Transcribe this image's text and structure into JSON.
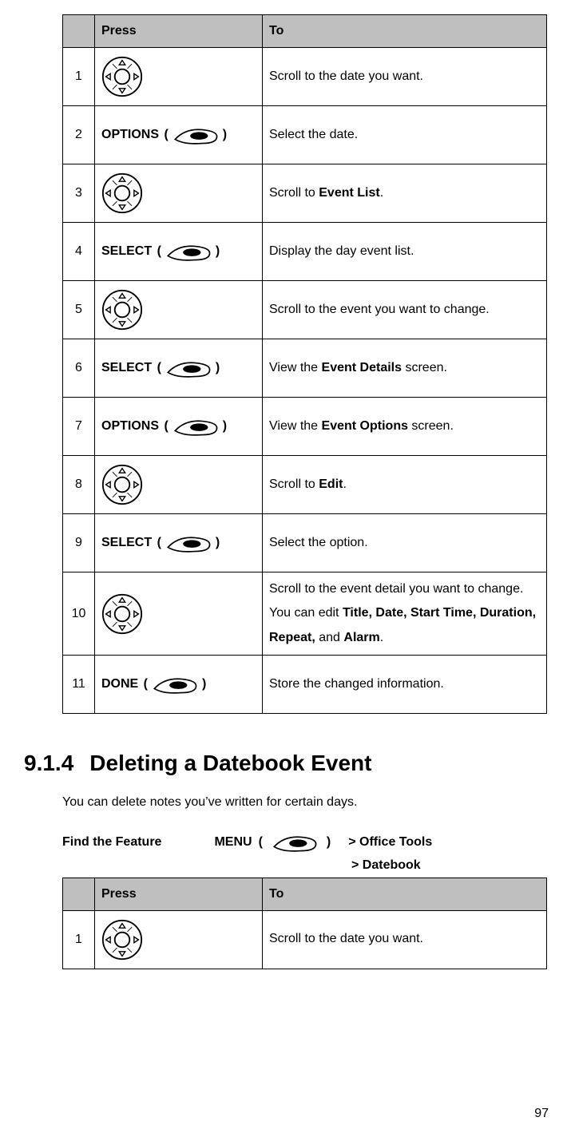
{
  "table1": {
    "headers": {
      "num": "",
      "press": "Press",
      "to": "To"
    },
    "rows": [
      {
        "num": "1",
        "press_type": "nav",
        "to": "Scroll to the date you want."
      },
      {
        "num": "2",
        "press_type": "soft",
        "press_label": "OPTIONS",
        "to": "Select the date."
      },
      {
        "num": "3",
        "press_type": "nav",
        "to_pre": "Scroll to ",
        "to_bold": "Event List",
        "to_post": "."
      },
      {
        "num": "4",
        "press_type": "soft",
        "press_label": "SELECT",
        "to": "Display the day event list."
      },
      {
        "num": "5",
        "press_type": "nav",
        "to": "Scroll to the event you want to change."
      },
      {
        "num": "6",
        "press_type": "soft",
        "press_label": "SELECT",
        "to_pre": "View the ",
        "to_bold": "Event Details",
        "to_post": " screen."
      },
      {
        "num": "7",
        "press_type": "soft",
        "press_label": "OPTIONS",
        "to_pre": "View the ",
        "to_bold": "Event Options",
        "to_post": " screen."
      },
      {
        "num": "8",
        "press_type": "nav",
        "to_pre": "Scroll to ",
        "to_bold": "Edit",
        "to_post": "."
      },
      {
        "num": "9",
        "press_type": "soft",
        "press_label": "SELECT",
        "to": "Select the option."
      },
      {
        "num": "10",
        "press_type": "nav",
        "to_line1": "Scroll to the event detail you want to change.",
        "to_line2_pre": "You can edit ",
        "to_line2_b1": "Title, Date, Start Time, Duration, Repeat,",
        "to_line2_mid": " and ",
        "to_line2_b2": "Alarm",
        "to_line2_post": "."
      },
      {
        "num": "11",
        "press_type": "soft",
        "press_label": "DONE",
        "to": "Store the changed information."
      }
    ]
  },
  "section": {
    "number": "9.1.4",
    "title": "Deleting a Datebook Event"
  },
  "body": "You can delete notes you’ve written for certain days.",
  "feature": {
    "label": "Find the Feature",
    "menu": "MENU",
    "crumb1": "> Office Tools",
    "crumb2": "> Datebook"
  },
  "table2": {
    "headers": {
      "num": "",
      "press": "Press",
      "to": "To"
    },
    "rows": [
      {
        "num": "1",
        "press_type": "nav",
        "to": "Scroll to the date you want."
      }
    ]
  },
  "page_number": "97"
}
